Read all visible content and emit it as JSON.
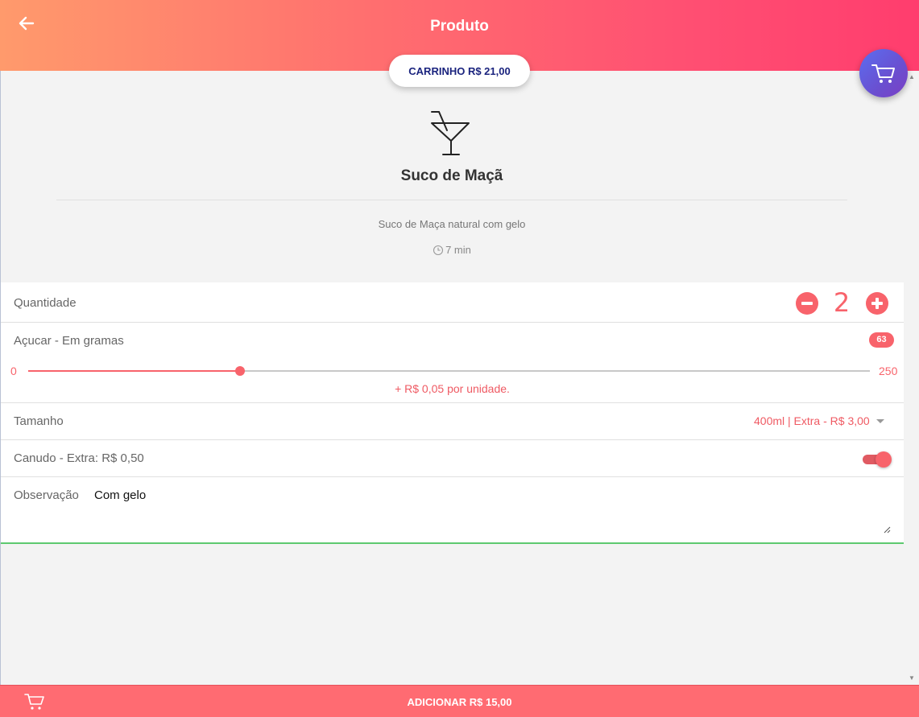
{
  "header": {
    "title": "Produto",
    "back_icon": "arrow-left-icon",
    "cart_pill": "CARRINHO R$ 21,00",
    "fab_icon": "shopping-cart-icon",
    "gradient": [
      "#ff9a6c",
      "#ff3d6e"
    ]
  },
  "product": {
    "icon": "cocktail-glass-icon",
    "name": "Suco de Maçã",
    "description": "Suco de Maça natural com gelo",
    "prep_time": "7 min",
    "prep_icon": "clock-icon"
  },
  "form": {
    "quantity": {
      "label": "Quantidade",
      "value": "2"
    },
    "sugar": {
      "label": "Açucar - Em gramas",
      "value": "63",
      "min": "0",
      "max": "250",
      "level": 0.252,
      "price_note": "+ R$ 0,05 por unidade."
    },
    "size": {
      "label": "Tamanho",
      "selected": "400ml | Extra - R$ 3,00"
    },
    "straw": {
      "label": "Canudo - Extra: R$ 0,50",
      "enabled": true
    },
    "notes": {
      "label": "Observação",
      "value": "Com gelo"
    }
  },
  "footer": {
    "cart_icon": "shopping-cart-icon",
    "add_label": "ADICIONAR R$ 15,00"
  },
  "colors": {
    "accent": "#f8636b",
    "cart_text": "#1a237e",
    "fab": "#5b6ef0",
    "focus_line": "#5dc96f"
  }
}
